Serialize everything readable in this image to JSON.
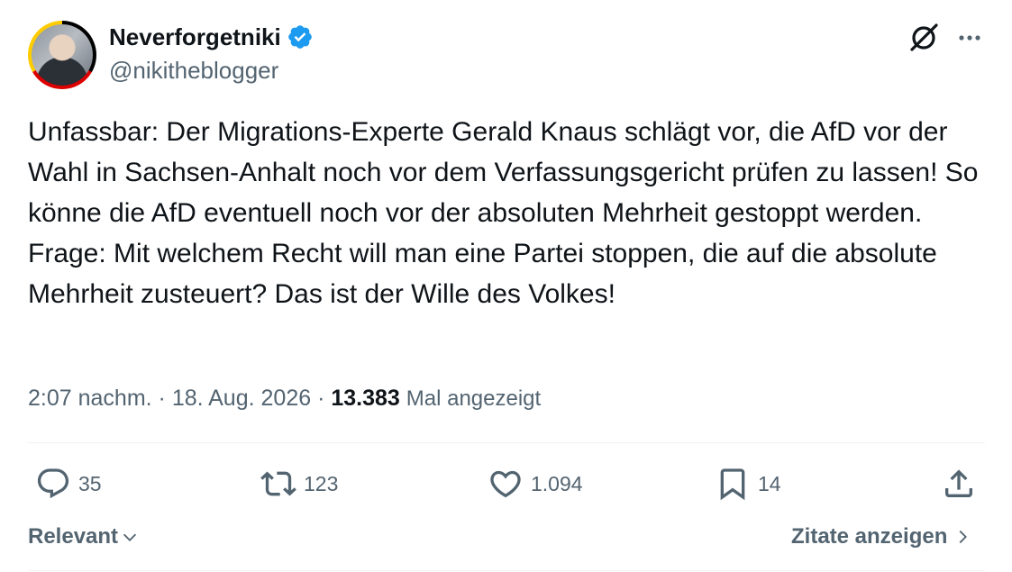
{
  "author": {
    "display_name": "Neverforgetniki",
    "handle": "@nikitheblogger",
    "verified": true
  },
  "tweet": {
    "paragraph_1": "Unfassbar: Der Migrations-Experte Gerald Knaus schlägt vor, die AfD vor der Wahl in Sachsen-Anhalt noch vor dem Verfassungsgericht prüfen zu lassen! So könne die AfD eventuell noch vor der absoluten Mehrheit gestoppt werden.",
    "paragraph_2": "Frage: Mit welchem Recht will man eine Partei stoppen, die auf die absolute Mehrheit zusteuert? Das ist der Wille des Volkes!"
  },
  "meta": {
    "time": "2:07 nachm.",
    "separator": " · ",
    "date": "18. Aug. 2026",
    "views_count": "13.383",
    "views_label": "Mal angezeigt"
  },
  "actions": {
    "replies": "35",
    "reposts": "123",
    "likes": "1.094",
    "bookmarks": "14"
  },
  "footer": {
    "sort_label": "Relevant",
    "quotes_label": "Zitate anzeigen"
  },
  "icons": {
    "verified": "verified-badge-icon",
    "grok": "grok-icon",
    "more": "more-icon",
    "reply": "reply-icon",
    "repost": "repost-icon",
    "like": "heart-icon",
    "bookmark": "bookmark-icon",
    "share": "share-icon",
    "chevron_down": "chevron-down-icon",
    "chevron_right": "chevron-right-icon"
  },
  "colors": {
    "verified_blue": "#1d9bf0",
    "text_primary": "#0f1419",
    "text_secondary": "#536471",
    "divider": "#eff3f4"
  }
}
